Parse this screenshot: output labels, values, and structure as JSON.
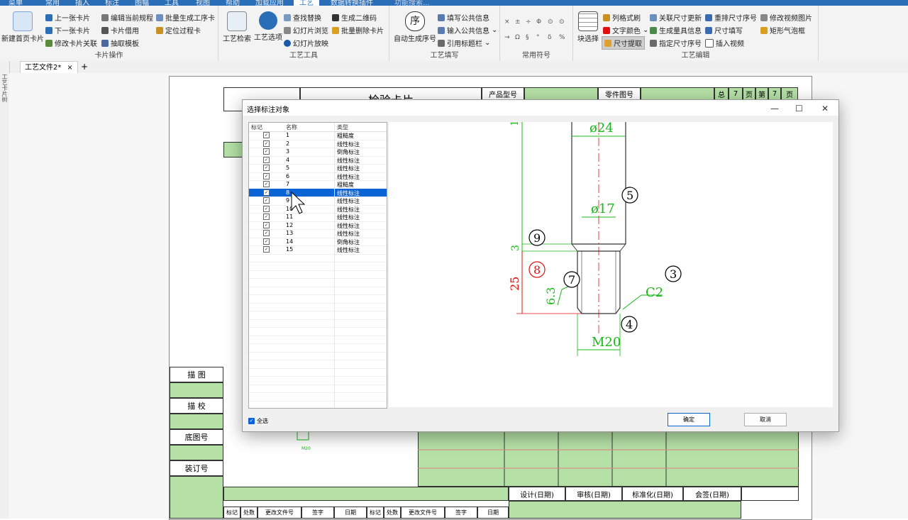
{
  "menu": {
    "tabs": [
      "菜单",
      "常用",
      "插入",
      "标注",
      "图幅",
      "工具",
      "视图",
      "帮助",
      "加载应用",
      "工艺",
      "数据转换插件"
    ],
    "active": "工艺",
    "search": "功能搜索..."
  },
  "ribbon": {
    "card_ops": {
      "label": "卡片操作",
      "new_first": "新建首页卡片",
      "prev": "上一张卡片",
      "next": "下一张卡片",
      "modify_link": "修改卡片关联",
      "edit_rule": "编辑当前规程",
      "borrow": "卡片借用",
      "extract_tpl": "抽取模板",
      "batch_gen": "批量生成工序卡",
      "locate": "定位过程卡"
    },
    "tools": {
      "label": "工艺工具",
      "search": "工艺检索",
      "options": "工艺选项",
      "find_replace": "查找替换",
      "qr": "生成二维码",
      "slide_browse": "幻灯片浏览",
      "batch_delete": "批量删除卡片",
      "slide_play": "幻灯片放映"
    },
    "fill": {
      "label": "工艺填写",
      "auto_seq": "自动生成序号",
      "seq_glyph": "序",
      "fill_public": "填写公共信息",
      "input_public": "输入公共信息",
      "ref_title": "引用标题栏"
    },
    "symbols": {
      "label": "常用符号",
      "row1": [
        "×",
        "±",
        "÷",
        "Φ",
        "⊙",
        "⊙"
      ],
      "row2": [
        "→",
        "Ω",
        "§",
        "°",
        "δ",
        "%"
      ]
    },
    "edit": {
      "label": "工艺编辑",
      "block_select": "块选择",
      "format_brush": "列格式刷",
      "text_color": "文字颜色",
      "dim_extract": "尺寸提取",
      "link_update": "关联尺寸更新",
      "gen_gauge": "生成量具信息",
      "assign_seq": "指定尺寸序号",
      "reorder": "重排尺寸序号",
      "dim_fill": "尺寸填写",
      "insert_video": "插入视频",
      "modify_video_img": "修改视频图片",
      "rect_bubble": "矩形气泡框"
    }
  },
  "doc_tab": {
    "name": "工艺文件2*",
    "close": "×",
    "add": "+"
  },
  "left_strip": "工艺卡片树",
  "sheet": {
    "title_partial": "检验卡片",
    "product_no_label": "产品型号",
    "part_no_label": "零件图号",
    "total": "总",
    "total_n": "7",
    "page_unit": "页",
    "page_prefix": "第",
    "page_n": "7",
    "left_labels": [
      "描 图",
      "描 校",
      "底图号",
      "装订号"
    ],
    "sign_labels": [
      "设计(日期)",
      "审核(日期)",
      "标准化(日期)",
      "会签(日期)"
    ],
    "rev_labels": [
      "标记",
      "处数",
      "更改文件号",
      "签字",
      "日期",
      "标记",
      "处数",
      "更改文件号",
      "签字",
      "日期"
    ],
    "thumb_label": "M20"
  },
  "dialog": {
    "title": "选择标注对象",
    "min": "—",
    "max": "☐",
    "close": "✕",
    "columns": [
      "标记",
      "名称",
      "类型"
    ],
    "rows": [
      {
        "name": "1",
        "type": "粗糙度"
      },
      {
        "name": "2",
        "type": "线性标注"
      },
      {
        "name": "3",
        "type": "倒角标注"
      },
      {
        "name": "4",
        "type": "线性标注"
      },
      {
        "name": "5",
        "type": "线性标注"
      },
      {
        "name": "6",
        "type": "线性标注"
      },
      {
        "name": "7",
        "type": "粗糙度"
      },
      {
        "name": "8",
        "type": "线性标注"
      },
      {
        "name": "9",
        "type": "线性标注"
      },
      {
        "name": "10",
        "type": "线性标注"
      },
      {
        "name": "11",
        "type": "线性标注"
      },
      {
        "name": "12",
        "type": "线性标注"
      },
      {
        "name": "13",
        "type": "线性标注"
      },
      {
        "name": "14",
        "type": "倒角标注"
      },
      {
        "name": "15",
        "type": "线性标注"
      }
    ],
    "selected_row": "8",
    "select_all": "全选",
    "ok": "确定",
    "cancel": "取消",
    "drawing": {
      "d24": "ø24",
      "d17": "ø17",
      "m20": "M20",
      "c2": "C2",
      "dim3": "3",
      "dim25": "25",
      "rough": "6.3",
      "dim_top": "1",
      "balloons": [
        "5",
        "9",
        "8",
        "7",
        "3",
        "4"
      ]
    }
  },
  "colors": {
    "accent": "#2a6eb8",
    "select": "#0a64d6",
    "cad_green": "#18b818",
    "cad_red": "#e01010",
    "sheet_green": "#b5e0a6"
  }
}
